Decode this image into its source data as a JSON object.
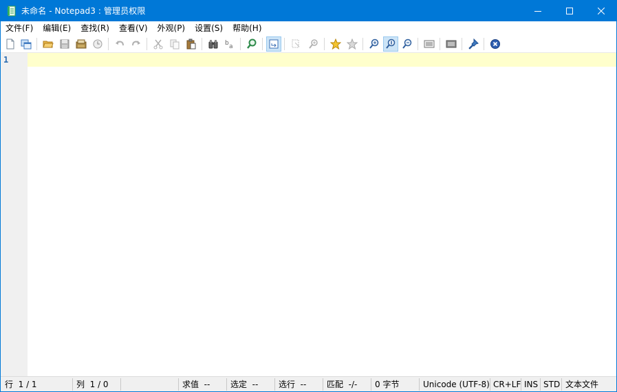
{
  "window": {
    "title": "未命名 - Notepad3 : 管理员权限"
  },
  "menu": {
    "items": [
      {
        "label": "文件(F)"
      },
      {
        "label": "编辑(E)"
      },
      {
        "label": "查找(R)"
      },
      {
        "label": "查看(V)"
      },
      {
        "label": "外观(P)"
      },
      {
        "label": "设置(S)"
      },
      {
        "label": "帮助(H)"
      }
    ]
  },
  "toolbar": {
    "icons": [
      "new-file-icon",
      "new-window-icon",
      "open-folder-icon",
      "save-icon",
      "save-as-icon",
      "recent-files-icon",
      "undo-icon",
      "redo-icon",
      "cut-icon",
      "copy-icon",
      "paste-icon",
      "find-icon",
      "replace-icon",
      "goto-icon",
      "word-wrap-icon",
      "bookmark-select-icon",
      "find-in-files-icon",
      "favorite-icon",
      "add-favorite-icon",
      "zoom-in-icon",
      "zoom-reset-icon",
      "zoom-out-icon",
      "scheme-icon",
      "customize-icon",
      "pin-icon",
      "exit-icon"
    ],
    "pressed": [
      "word-wrap-icon",
      "zoom-reset-icon"
    ]
  },
  "editor": {
    "line_number": "1",
    "current_line_color": "#ffffcc",
    "gutter_color": "#f0f0f0"
  },
  "statusbar": {
    "line": "行  1 / 1",
    "column": "列  1 / 0",
    "sum": "求值  --",
    "selection": "选定  --",
    "selected_lines": "选行  --",
    "match": "匹配  -/-",
    "bytes": "0 字节",
    "encoding": "Unicode (UTF-8)",
    "eol": "CR+LF",
    "ovr": "INS",
    "mode": "STD",
    "file_type": "文本文件"
  },
  "colors": {
    "titlebar": "#0078d7",
    "accent": "#2b6cb0"
  }
}
